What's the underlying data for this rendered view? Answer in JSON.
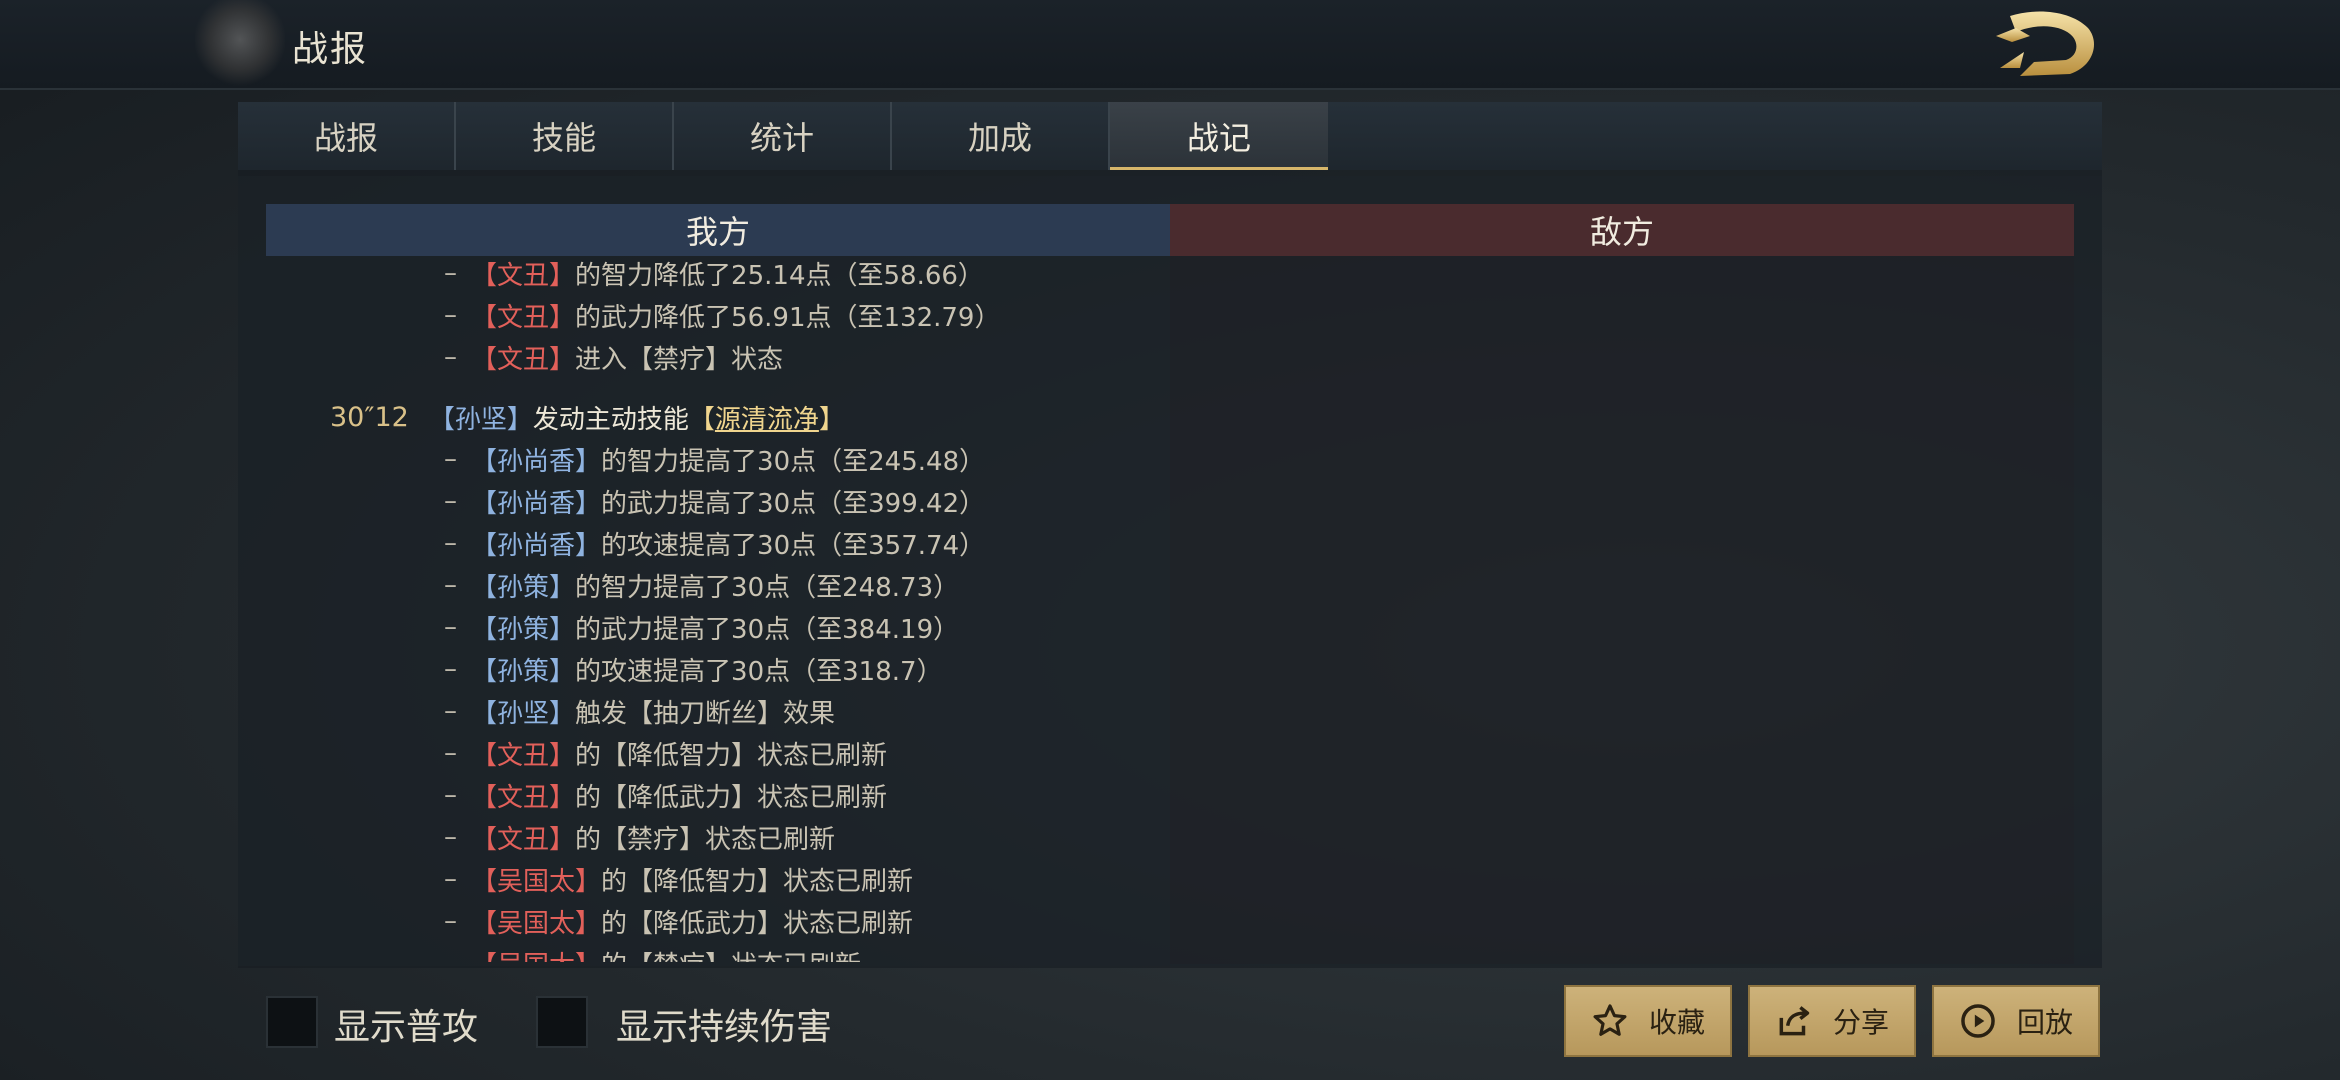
{
  "header": {
    "title": "战报",
    "logo": "dragon-logo"
  },
  "tabs": [
    {
      "label": "战报",
      "active": false
    },
    {
      "label": "技能",
      "active": false
    },
    {
      "label": "统计",
      "active": false
    },
    {
      "label": "加成",
      "active": false
    },
    {
      "label": "战记",
      "active": true
    }
  ],
  "sides": {
    "own": "我方",
    "enemy": "敌方"
  },
  "log": {
    "prev_lines": [
      {
        "open": "【",
        "name": "文丑",
        "close": "】",
        "text": "的智力降低了25.14点（至58.66）",
        "name_color": "red"
      },
      {
        "open": "【",
        "name": "文丑",
        "close": "】",
        "text": "的武力降低了56.91点（至132.79）",
        "name_color": "red"
      },
      {
        "open": "【",
        "name": "文丑",
        "close": "】",
        "text": "进入【禁疗】状态",
        "name_color": "red"
      }
    ],
    "event": {
      "time": "30″12",
      "open": "【",
      "actor": "孙坚",
      "close": "】",
      "action": "发动主动技能",
      "skill_open": "【",
      "skill": "源清流净",
      "skill_close": "】"
    },
    "lines": [
      {
        "open": "【",
        "name": "孙尚香",
        "close": "】",
        "text": "的智力提高了30点（至245.48）",
        "name_color": "blue"
      },
      {
        "open": "【",
        "name": "孙尚香",
        "close": "】",
        "text": "的武力提高了30点（至399.42）",
        "name_color": "blue"
      },
      {
        "open": "【",
        "name": "孙尚香",
        "close": "】",
        "text": "的攻速提高了30点（至357.74）",
        "name_color": "blue"
      },
      {
        "open": "【",
        "name": "孙策",
        "close": "】",
        "text": "的智力提高了30点（至248.73）",
        "name_color": "blue"
      },
      {
        "open": "【",
        "name": "孙策",
        "close": "】",
        "text": "的武力提高了30点（至384.19）",
        "name_color": "blue"
      },
      {
        "open": "【",
        "name": "孙策",
        "close": "】",
        "text": "的攻速提高了30点（至318.7）",
        "name_color": "blue"
      },
      {
        "open": "【",
        "name": "孙坚",
        "close": "】",
        "text": "触发【抽刀断丝】效果",
        "name_color": "blue"
      },
      {
        "open": "【",
        "name": "文丑",
        "close": "】",
        "text": "的【降低智力】状态已刷新",
        "name_color": "red"
      },
      {
        "open": "【",
        "name": "文丑",
        "close": "】",
        "text": "的【降低武力】状态已刷新",
        "name_color": "red"
      },
      {
        "open": "【",
        "name": "文丑",
        "close": "】",
        "text": "的【禁疗】状态已刷新",
        "name_color": "red"
      },
      {
        "open": "【",
        "name": "吴国太",
        "close": "】",
        "text": "的【降低智力】状态已刷新",
        "name_color": "red"
      },
      {
        "open": "【",
        "name": "吴国太",
        "close": "】",
        "text": "的【降低武力】状态已刷新",
        "name_color": "red"
      },
      {
        "open": "【",
        "name": "吴国太",
        "close": "】",
        "text": "的【禁疗】状态已刷新",
        "name_color": "red"
      }
    ]
  },
  "footer": {
    "show_normal_attack": "显示普攻",
    "show_dot": "显示持续伤害",
    "favorite": "收藏",
    "share": "分享",
    "replay": "回放"
  },
  "colors": {
    "own_name": "#8fb3e0",
    "enemy_name": "#e2605a",
    "accent_gold": "#d6b66a",
    "button_gold": "#c6aa6e"
  }
}
